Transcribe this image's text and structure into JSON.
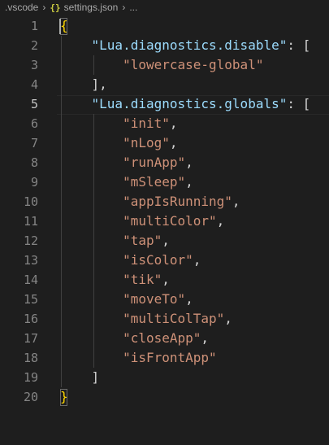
{
  "breadcrumb": {
    "folder": ".vscode",
    "file_icon": "{}",
    "file": "settings.json",
    "more": "..."
  },
  "editor": {
    "active_line": 5,
    "line_numbers": [
      "1",
      "2",
      "3",
      "4",
      "5",
      "6",
      "7",
      "8",
      "9",
      "10",
      "11",
      "12",
      "13",
      "14",
      "15",
      "16",
      "17",
      "18",
      "19",
      "20"
    ],
    "lines": {
      "l1": {
        "bracket": "{"
      },
      "l2": {
        "key": "\"Lua.diagnostics.disable\"",
        "colon": ": ",
        "open": "["
      },
      "l3": {
        "value": "\"lowercase-global\""
      },
      "l4": {
        "close": "]",
        "comma": ","
      },
      "l5": {
        "key": "\"Lua.diagnostics.globals\"",
        "colon": ": ",
        "open": "["
      },
      "l6": {
        "value": "\"init\"",
        "comma": ","
      },
      "l7": {
        "value": "\"nLog\"",
        "comma": ","
      },
      "l8": {
        "value": "\"runApp\"",
        "comma": ","
      },
      "l9": {
        "value": "\"mSleep\"",
        "comma": ","
      },
      "l10": {
        "value": "\"appIsRunning\"",
        "comma": ","
      },
      "l11": {
        "value": "\"multiColor\"",
        "comma": ","
      },
      "l12": {
        "value": "\"tap\"",
        "comma": ","
      },
      "l13": {
        "value": "\"isColor\"",
        "comma": ","
      },
      "l14": {
        "value": "\"tik\"",
        "comma": ","
      },
      "l15": {
        "value": "\"moveTo\"",
        "comma": ","
      },
      "l16": {
        "value": "\"multiColTap\"",
        "comma": ","
      },
      "l17": {
        "value": "\"closeApp\"",
        "comma": ","
      },
      "l18": {
        "value": "\"isFrontApp\""
      },
      "l19": {
        "close": "]"
      },
      "l20": {
        "bracket": "}"
      }
    }
  },
  "colors": {
    "background": "#1e1e1e",
    "key": "#9cdcfe",
    "string": "#ce9178",
    "bracket": "#ffd700",
    "line_number": "#858585"
  },
  "icons": [
    "chevron-right-icon",
    "json-file-icon"
  ]
}
